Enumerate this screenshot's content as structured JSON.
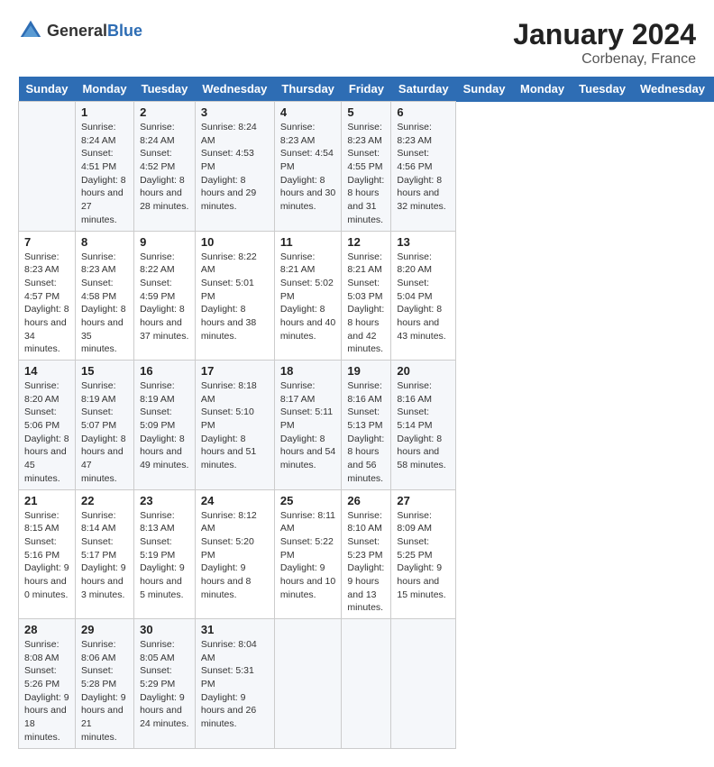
{
  "header": {
    "logo": {
      "text_general": "General",
      "text_blue": "Blue"
    },
    "title": "January 2024",
    "subtitle": "Corbenay, France"
  },
  "calendar": {
    "days_of_week": [
      "Sunday",
      "Monday",
      "Tuesday",
      "Wednesday",
      "Thursday",
      "Friday",
      "Saturday"
    ],
    "weeks": [
      [
        {
          "num": "",
          "sunrise": "",
          "sunset": "",
          "daylight": ""
        },
        {
          "num": "1",
          "sunrise": "Sunrise: 8:24 AM",
          "sunset": "Sunset: 4:51 PM",
          "daylight": "Daylight: 8 hours and 27 minutes."
        },
        {
          "num": "2",
          "sunrise": "Sunrise: 8:24 AM",
          "sunset": "Sunset: 4:52 PM",
          "daylight": "Daylight: 8 hours and 28 minutes."
        },
        {
          "num": "3",
          "sunrise": "Sunrise: 8:24 AM",
          "sunset": "Sunset: 4:53 PM",
          "daylight": "Daylight: 8 hours and 29 minutes."
        },
        {
          "num": "4",
          "sunrise": "Sunrise: 8:23 AM",
          "sunset": "Sunset: 4:54 PM",
          "daylight": "Daylight: 8 hours and 30 minutes."
        },
        {
          "num": "5",
          "sunrise": "Sunrise: 8:23 AM",
          "sunset": "Sunset: 4:55 PM",
          "daylight": "Daylight: 8 hours and 31 minutes."
        },
        {
          "num": "6",
          "sunrise": "Sunrise: 8:23 AM",
          "sunset": "Sunset: 4:56 PM",
          "daylight": "Daylight: 8 hours and 32 minutes."
        }
      ],
      [
        {
          "num": "7",
          "sunrise": "Sunrise: 8:23 AM",
          "sunset": "Sunset: 4:57 PM",
          "daylight": "Daylight: 8 hours and 34 minutes."
        },
        {
          "num": "8",
          "sunrise": "Sunrise: 8:23 AM",
          "sunset": "Sunset: 4:58 PM",
          "daylight": "Daylight: 8 hours and 35 minutes."
        },
        {
          "num": "9",
          "sunrise": "Sunrise: 8:22 AM",
          "sunset": "Sunset: 4:59 PM",
          "daylight": "Daylight: 8 hours and 37 minutes."
        },
        {
          "num": "10",
          "sunrise": "Sunrise: 8:22 AM",
          "sunset": "Sunset: 5:01 PM",
          "daylight": "Daylight: 8 hours and 38 minutes."
        },
        {
          "num": "11",
          "sunrise": "Sunrise: 8:21 AM",
          "sunset": "Sunset: 5:02 PM",
          "daylight": "Daylight: 8 hours and 40 minutes."
        },
        {
          "num": "12",
          "sunrise": "Sunrise: 8:21 AM",
          "sunset": "Sunset: 5:03 PM",
          "daylight": "Daylight: 8 hours and 42 minutes."
        },
        {
          "num": "13",
          "sunrise": "Sunrise: 8:20 AM",
          "sunset": "Sunset: 5:04 PM",
          "daylight": "Daylight: 8 hours and 43 minutes."
        }
      ],
      [
        {
          "num": "14",
          "sunrise": "Sunrise: 8:20 AM",
          "sunset": "Sunset: 5:06 PM",
          "daylight": "Daylight: 8 hours and 45 minutes."
        },
        {
          "num": "15",
          "sunrise": "Sunrise: 8:19 AM",
          "sunset": "Sunset: 5:07 PM",
          "daylight": "Daylight: 8 hours and 47 minutes."
        },
        {
          "num": "16",
          "sunrise": "Sunrise: 8:19 AM",
          "sunset": "Sunset: 5:09 PM",
          "daylight": "Daylight: 8 hours and 49 minutes."
        },
        {
          "num": "17",
          "sunrise": "Sunrise: 8:18 AM",
          "sunset": "Sunset: 5:10 PM",
          "daylight": "Daylight: 8 hours and 51 minutes."
        },
        {
          "num": "18",
          "sunrise": "Sunrise: 8:17 AM",
          "sunset": "Sunset: 5:11 PM",
          "daylight": "Daylight: 8 hours and 54 minutes."
        },
        {
          "num": "19",
          "sunrise": "Sunrise: 8:16 AM",
          "sunset": "Sunset: 5:13 PM",
          "daylight": "Daylight: 8 hours and 56 minutes."
        },
        {
          "num": "20",
          "sunrise": "Sunrise: 8:16 AM",
          "sunset": "Sunset: 5:14 PM",
          "daylight": "Daylight: 8 hours and 58 minutes."
        }
      ],
      [
        {
          "num": "21",
          "sunrise": "Sunrise: 8:15 AM",
          "sunset": "Sunset: 5:16 PM",
          "daylight": "Daylight: 9 hours and 0 minutes."
        },
        {
          "num": "22",
          "sunrise": "Sunrise: 8:14 AM",
          "sunset": "Sunset: 5:17 PM",
          "daylight": "Daylight: 9 hours and 3 minutes."
        },
        {
          "num": "23",
          "sunrise": "Sunrise: 8:13 AM",
          "sunset": "Sunset: 5:19 PM",
          "daylight": "Daylight: 9 hours and 5 minutes."
        },
        {
          "num": "24",
          "sunrise": "Sunrise: 8:12 AM",
          "sunset": "Sunset: 5:20 PM",
          "daylight": "Daylight: 9 hours and 8 minutes."
        },
        {
          "num": "25",
          "sunrise": "Sunrise: 8:11 AM",
          "sunset": "Sunset: 5:22 PM",
          "daylight": "Daylight: 9 hours and 10 minutes."
        },
        {
          "num": "26",
          "sunrise": "Sunrise: 8:10 AM",
          "sunset": "Sunset: 5:23 PM",
          "daylight": "Daylight: 9 hours and 13 minutes."
        },
        {
          "num": "27",
          "sunrise": "Sunrise: 8:09 AM",
          "sunset": "Sunset: 5:25 PM",
          "daylight": "Daylight: 9 hours and 15 minutes."
        }
      ],
      [
        {
          "num": "28",
          "sunrise": "Sunrise: 8:08 AM",
          "sunset": "Sunset: 5:26 PM",
          "daylight": "Daylight: 9 hours and 18 minutes."
        },
        {
          "num": "29",
          "sunrise": "Sunrise: 8:06 AM",
          "sunset": "Sunset: 5:28 PM",
          "daylight": "Daylight: 9 hours and 21 minutes."
        },
        {
          "num": "30",
          "sunrise": "Sunrise: 8:05 AM",
          "sunset": "Sunset: 5:29 PM",
          "daylight": "Daylight: 9 hours and 24 minutes."
        },
        {
          "num": "31",
          "sunrise": "Sunrise: 8:04 AM",
          "sunset": "Sunset: 5:31 PM",
          "daylight": "Daylight: 9 hours and 26 minutes."
        },
        {
          "num": "",
          "sunrise": "",
          "sunset": "",
          "daylight": ""
        },
        {
          "num": "",
          "sunrise": "",
          "sunset": "",
          "daylight": ""
        },
        {
          "num": "",
          "sunrise": "",
          "sunset": "",
          "daylight": ""
        }
      ]
    ]
  }
}
